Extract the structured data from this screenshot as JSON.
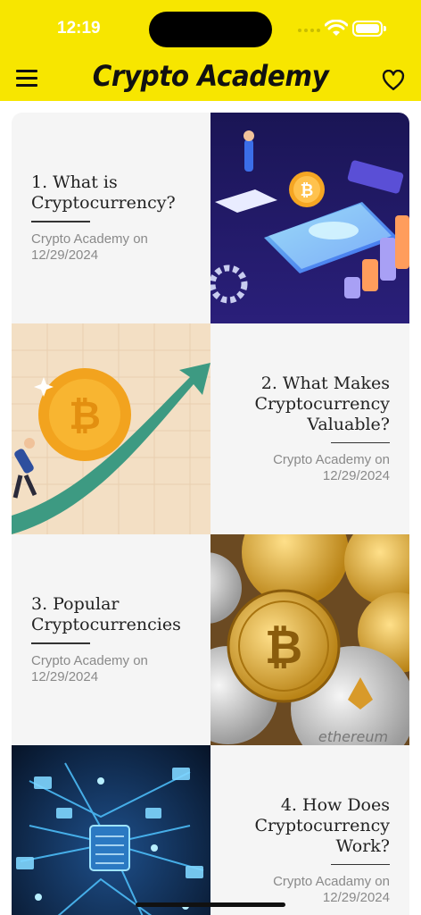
{
  "status": {
    "time": "12:19"
  },
  "header": {
    "title": "Crypto Academy",
    "menu_icon": "hamburger-icon",
    "favorite_icon": "heart-outline-icon",
    "background": "#f7e600"
  },
  "articles": [
    {
      "title": "1. What is Cryptocurrency?",
      "meta": "Crypto Academy on 12/29/2024",
      "image": "phone-bitcoin-illustration"
    },
    {
      "title": "2. What Makes Cryptocurrency Valuable?",
      "meta": "Crypto Academy on 12/29/2024",
      "image": "bitcoin-growth-arrow-illustration"
    },
    {
      "title": "3. Popular Cryptocurrencies",
      "meta": "Crypto Academy on 12/29/2024",
      "image": "crypto-coins-photo"
    },
    {
      "title": "4. How Does Cryptocurrency Work?",
      "meta": "Crypto Acadamy on 12/29/2024",
      "image": "blockchain-network-illustration"
    }
  ]
}
